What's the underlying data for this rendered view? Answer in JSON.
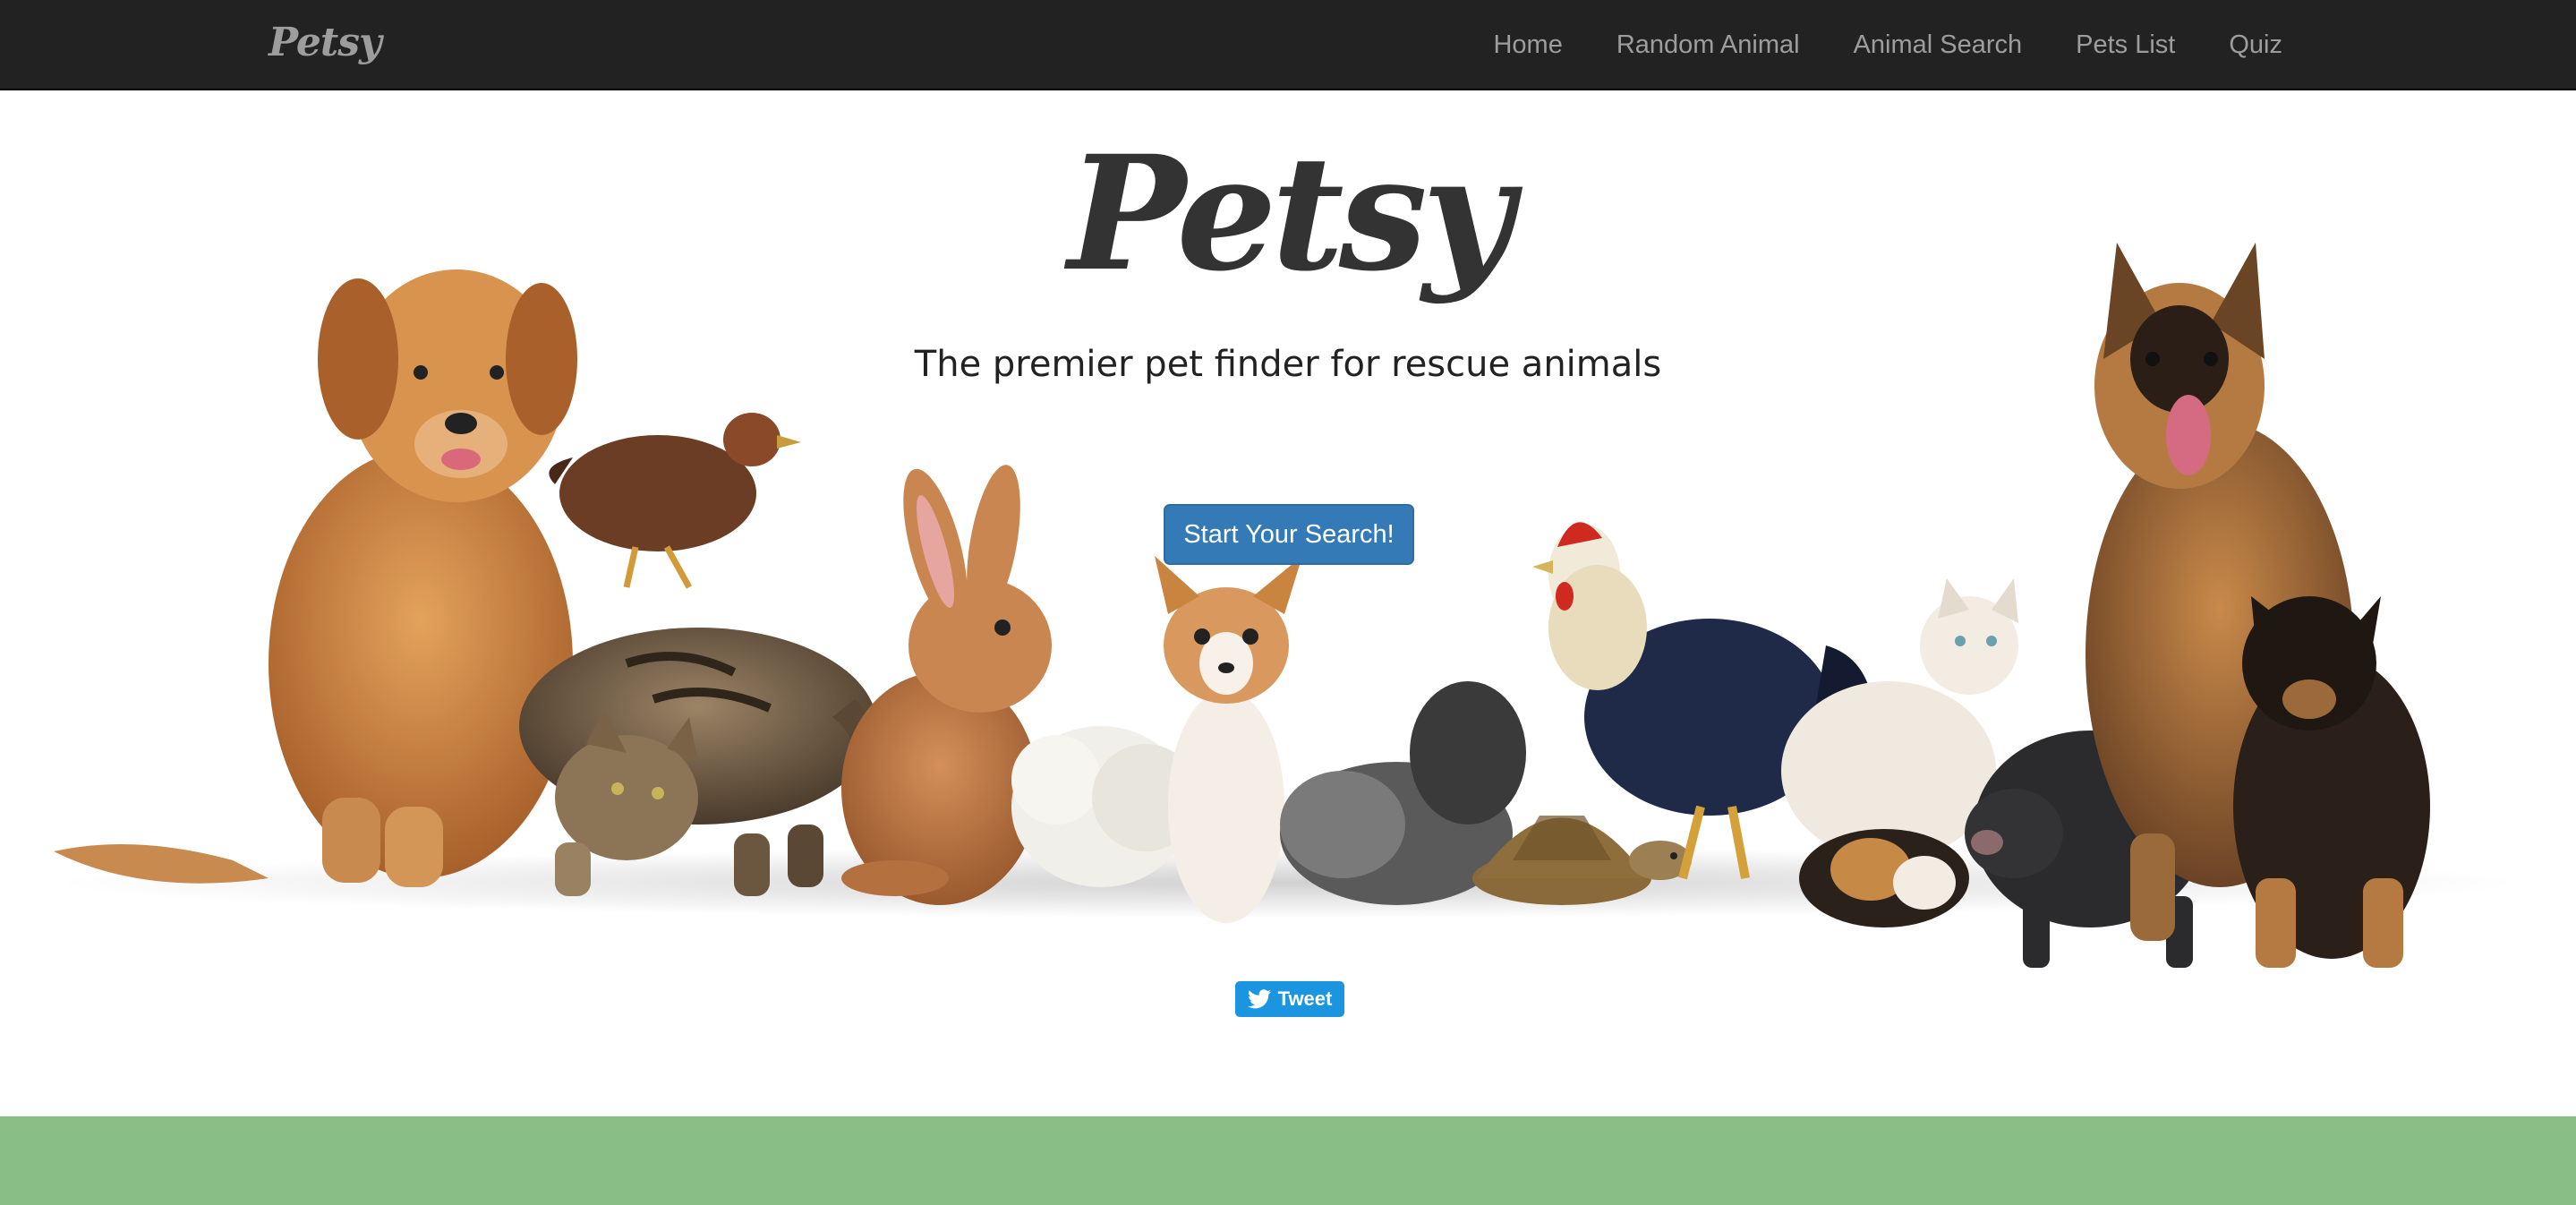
{
  "navbar": {
    "brand": "Petsy",
    "links": [
      {
        "label": "Home"
      },
      {
        "label": "Random Animal"
      },
      {
        "label": "Animal Search"
      },
      {
        "label": "Pets List"
      },
      {
        "label": "Quiz"
      }
    ]
  },
  "hero": {
    "title": "Petsy",
    "subtitle": "The premier pet finder for rescue animals",
    "cta_label": "Start Your Search!",
    "image_alt": "group of pets: dog, hen, cat, rabbit, chihuahua, silkie chickens, tortoise, rooster, guinea pig, pig, german shepherd and puppy"
  },
  "social": {
    "tweet_label": "Tweet",
    "tweet_icon": "twitter-bird-icon"
  },
  "colors": {
    "navbar_bg": "#222222",
    "nav_text": "#9d9d9d",
    "cta_bg": "#337ab7",
    "tweet_bg": "#1b95e0",
    "band_green": "#89bf87"
  }
}
